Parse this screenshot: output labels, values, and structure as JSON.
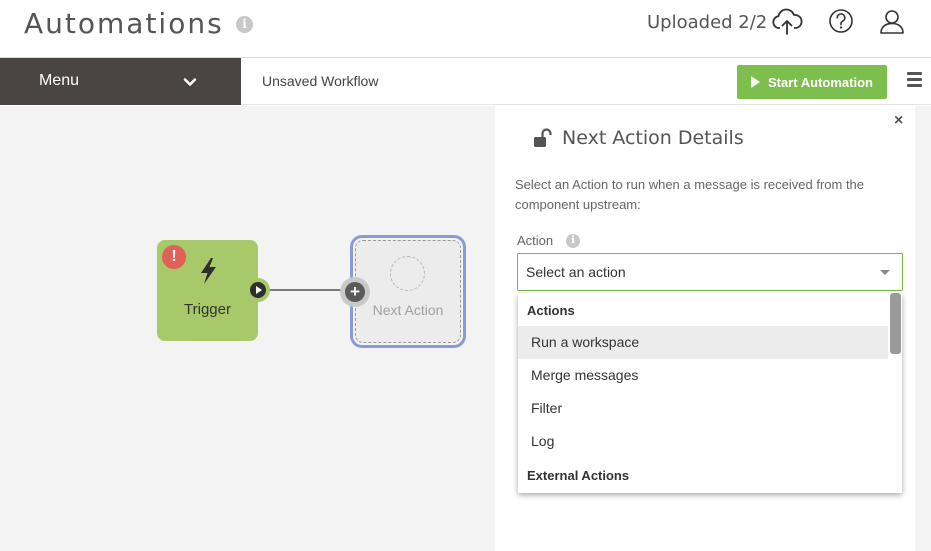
{
  "header": {
    "title": "Automations",
    "info_glyph": "i",
    "upload_status": "Uploaded 2/2",
    "icons": [
      "cloud-upload-icon",
      "help-icon",
      "user-icon"
    ]
  },
  "toolbar": {
    "menu_label": "Menu",
    "workflow_name": "Unsaved Workflow",
    "start_label": "Start Automation",
    "accent_color": "#7cbf4c"
  },
  "canvas": {
    "trigger": {
      "label": "Trigger",
      "error_glyph": "!"
    },
    "next_action": {
      "label": "Next Action",
      "port_glyph": "+"
    }
  },
  "panel": {
    "title": "Next Action Details",
    "close_glyph": "×",
    "description": "Select an Action to run when a message is received from the component upstream:",
    "action_label": "Action",
    "action_info_glyph": "i",
    "select_placeholder": "Select an action",
    "dropdown": {
      "group_actions": "Actions",
      "items": [
        "Run a workspace",
        "Merge messages",
        "Filter",
        "Log"
      ],
      "highlighted_item": "Run a workspace",
      "group_external": "External Actions"
    }
  }
}
